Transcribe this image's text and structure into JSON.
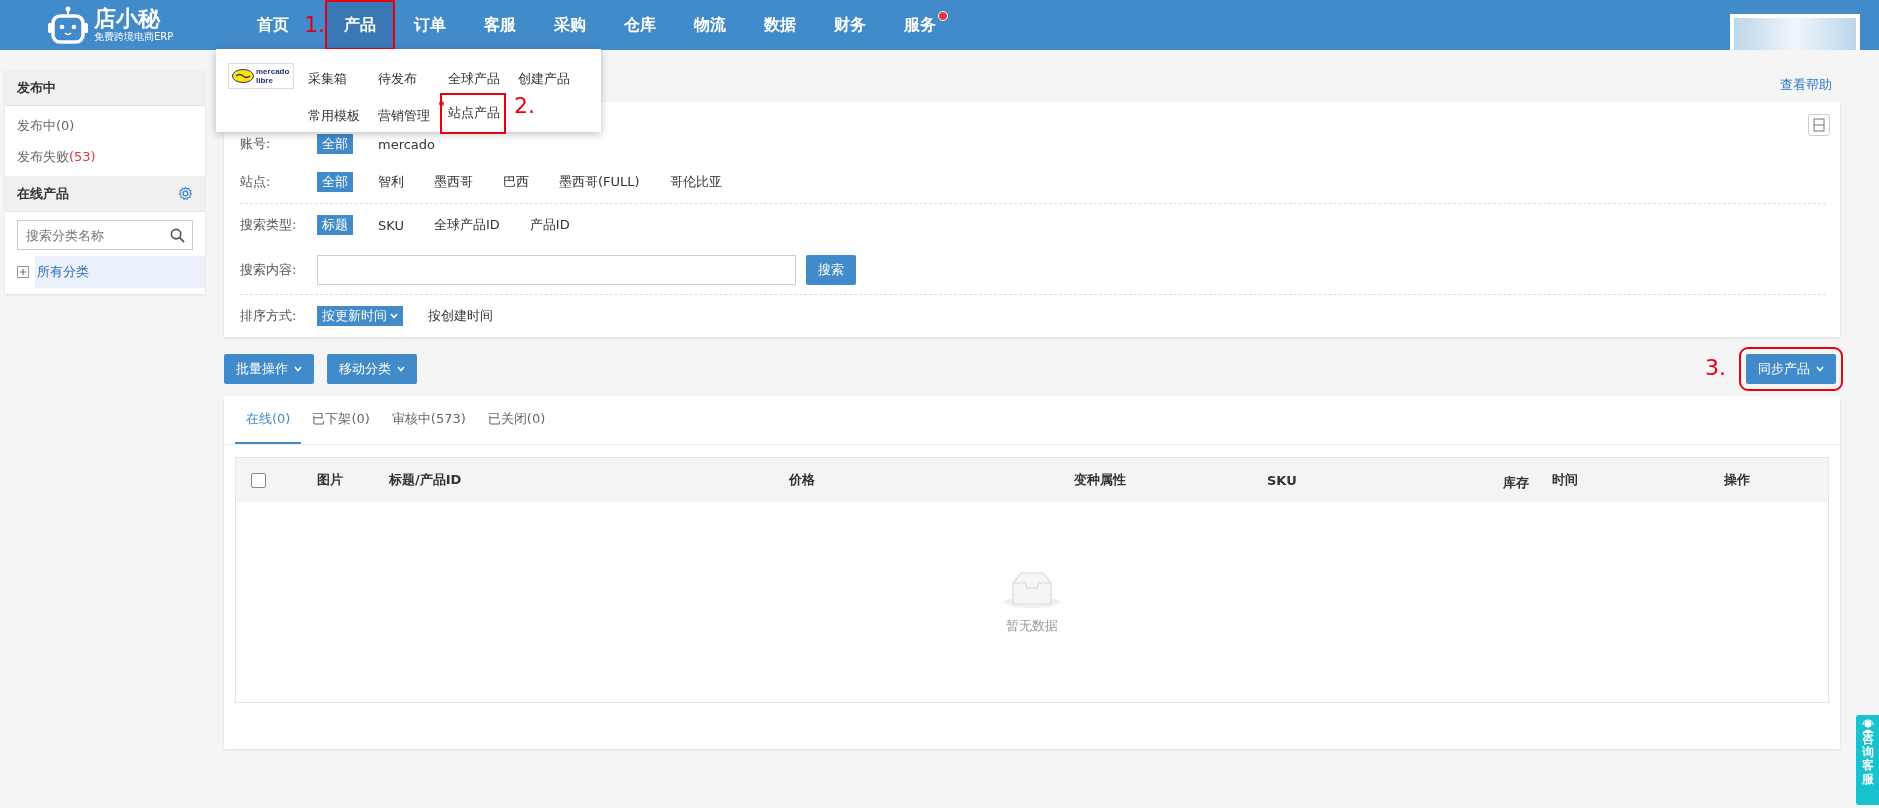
{
  "header": {
    "logo": {
      "name": "店小秘",
      "tagline": "免费跨境电商ERP"
    },
    "nav": [
      {
        "label": "首页",
        "selected": false,
        "dot": false
      },
      {
        "label": "产品",
        "selected": true,
        "dot": false,
        "marker": "1."
      },
      {
        "label": "订单",
        "selected": false,
        "dot": false
      },
      {
        "label": "客服",
        "selected": false,
        "dot": false
      },
      {
        "label": "采购",
        "selected": false,
        "dot": false
      },
      {
        "label": "仓库",
        "selected": false,
        "dot": false
      },
      {
        "label": "物流",
        "selected": false,
        "dot": false
      },
      {
        "label": "数据",
        "selected": false,
        "dot": false
      },
      {
        "label": "财务",
        "selected": false,
        "dot": false
      },
      {
        "label": "服务",
        "selected": false,
        "dot": true
      }
    ]
  },
  "dropdown": {
    "platform": "mercado libre",
    "items": [
      {
        "label": "采集箱",
        "dot": false
      },
      {
        "label": "待发布",
        "dot": false
      },
      {
        "label": "全球产品",
        "dot": false
      },
      {
        "label": "创建产品",
        "dot": false
      },
      {
        "label": "常用模板",
        "dot": false
      },
      {
        "label": "营销管理",
        "dot": true
      },
      {
        "label": "站点产品",
        "dot": false,
        "marker": "2."
      }
    ]
  },
  "sidebar": {
    "publish": {
      "title": "发布中",
      "items": [
        {
          "label": "发布中",
          "count": "(0)",
          "alert": false
        },
        {
          "label": "发布失败",
          "count": "(53)",
          "alert": true
        }
      ]
    },
    "online": {
      "title": "在线产品",
      "placeholder": "搜索分类名称",
      "tree": [
        {
          "label": "所有分类",
          "expanded": false
        }
      ]
    }
  },
  "help_link": "查看帮助",
  "filters": [
    {
      "kind": "options",
      "label": "账号:",
      "options": [
        {
          "label": "全部",
          "selected": true
        },
        {
          "label": "mercado",
          "selected": false
        }
      ]
    },
    {
      "kind": "options",
      "label": "站点:",
      "options": [
        {
          "label": "全部",
          "selected": true
        },
        {
          "label": "智利",
          "selected": false
        },
        {
          "label": "墨西哥",
          "selected": false
        },
        {
          "label": "巴西",
          "selected": false
        },
        {
          "label": "墨西哥(FULL)",
          "selected": false
        },
        {
          "label": "哥伦比亚",
          "selected": false
        }
      ]
    },
    {
      "kind": "options",
      "label": "搜索类型:",
      "options": [
        {
          "label": "标题",
          "selected": true
        },
        {
          "label": "SKU",
          "selected": false
        },
        {
          "label": "全球产品ID",
          "selected": false
        },
        {
          "label": "产品ID",
          "selected": false
        }
      ]
    },
    {
      "kind": "search",
      "label": "搜索内容:",
      "button": "搜索"
    },
    {
      "kind": "sort",
      "label": "排序方式:",
      "options": [
        {
          "label": "按更新时间",
          "selected": true
        },
        {
          "label": "按创建时间",
          "selected": false
        }
      ]
    }
  ],
  "actions": [
    "批量操作",
    "移动分类"
  ],
  "sync": {
    "label": "同步产品",
    "marker": "3."
  },
  "tabs": [
    {
      "label": "在线(0)",
      "selected": true
    },
    {
      "label": "已下架(0)",
      "selected": false
    },
    {
      "label": "审核中(573)",
      "selected": false
    },
    {
      "label": "已关闭(0)",
      "selected": false
    }
  ],
  "table": {
    "columns": [
      "图片",
      "标题/产品ID",
      "价格",
      "变种属性",
      "SKU",
      "库存",
      "时间",
      "操作"
    ],
    "empty_text": "暂无数据",
    "select_all_checked": false
  },
  "consult_button": "咨询客服"
}
